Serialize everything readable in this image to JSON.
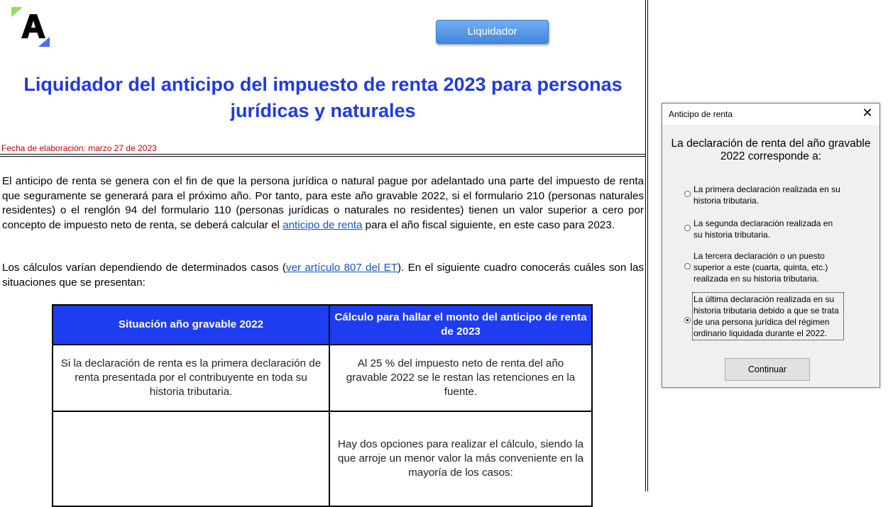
{
  "header": {
    "liquidador_button": "Liquidador",
    "title": "Liquidador del anticipo del impuesto de renta 2023 para personas jurídicas y naturales",
    "fecha": "Fecha de elaboración: marzo 27 de 2023"
  },
  "body": {
    "p1_before": "El anticipo de renta se genera con el fin de que la persona jurídica o natural pague por adelantado una parte del impuesto de renta que seguramente se generará para el próximo año. Por tanto, para este año gravable 2022, si el formulario 210 (personas naturales residentes) o el renglón 94 del formulario 110 (personas jurídicas o naturales no residentes) tienen un valor superior a cero por concepto de impuesto neto de renta, se deberá calcular el ",
    "p1_link": "anticipo de renta",
    "p1_after": " para el año fiscal siguiente, en este caso para 2023.",
    "p2_before": "Los cálculos varían dependiendo de determinados casos (",
    "p2_link": "ver artículo 807 del ET",
    "p2_after": "). En el siguiente cuadro conocerás cuáles son las situaciones que se presentan:"
  },
  "table": {
    "headers": [
      "Situación año gravable 2022",
      "Cálculo para hallar el monto del anticipo de renta de 2023"
    ],
    "rows": [
      [
        "Si la declaración de renta es la primera declaración de renta presentada por el contribuyente en toda su historia tributaria.",
        "Al 25 % del impuesto neto de renta del año gravable 2022 se le restan las retenciones en la fuente."
      ],
      [
        "",
        "Hay dos opciones para realizar el cálculo, siendo la que arroje un menor valor la más conveniente en la mayoría de los casos:"
      ]
    ]
  },
  "dialog": {
    "title": "Anticipo de renta",
    "close": "✕",
    "question": "La declaración de renta del año gravable 2022 corresponde a:",
    "options": [
      {
        "label": "La primera declaración realizada en su historia tributaria.",
        "selected": false
      },
      {
        "label": "La segunda declaración realizada en su historia tributaria.",
        "selected": false
      },
      {
        "label": "La tercera declaración o un puesto superior a este (cuarta, quinta, etc.) realizada en su historia tributaria.",
        "selected": false
      },
      {
        "label": "La última declaración realizada en su historia tributaria debido a que se trata de una persona jurídica del régimen ordinario liquidada durante el 2022.",
        "selected": true
      }
    ],
    "continue_button": "Continuar"
  },
  "colors": {
    "title": "#1f3be0",
    "table_header": "#1f3df0",
    "fecha": "#c00000",
    "link": "#1155cc",
    "logo_green": "#8ee05a",
    "logo_blue": "#4a6cf7"
  },
  "icons": {
    "logo": "actualicese-logo",
    "close": "close-icon"
  }
}
